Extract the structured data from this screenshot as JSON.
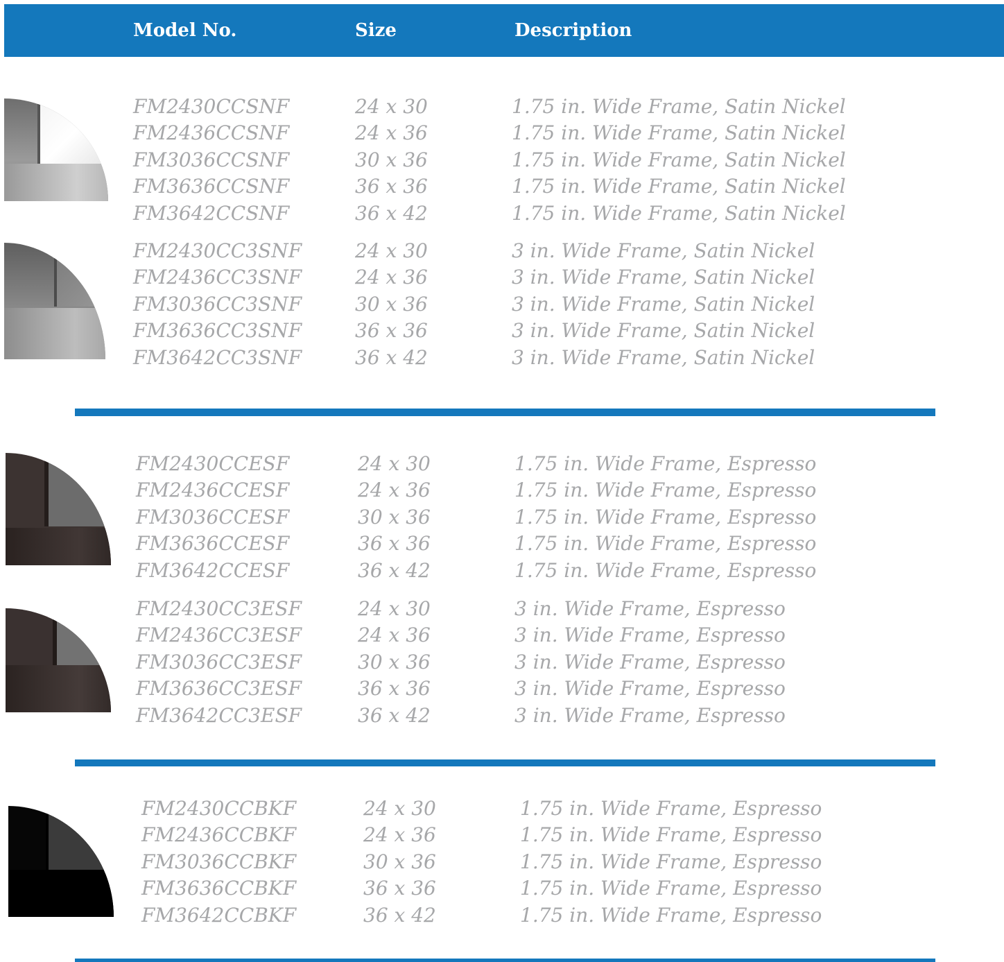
{
  "header": {
    "model_label": "Model No.",
    "size_label": "Size",
    "description_label": "Description"
  },
  "groups": [
    {
      "finish": "Satin Nickel",
      "subgroups": [
        {
          "rows": [
            {
              "model": "FM2430CCSNF",
              "size": "24 x 30",
              "description": "1.75 in. Wide Frame, Satin Nickel"
            },
            {
              "model": "FM2436CCSNF",
              "size": "24 x 36",
              "description": "1.75 in. Wide Frame, Satin Nickel"
            },
            {
              "model": "FM3036CCSNF",
              "size": "30 x 36",
              "description": "1.75 in. Wide Frame, Satin Nickel"
            },
            {
              "model": "FM3636CCSNF",
              "size": "36 x 36",
              "description": "1.75 in. Wide Frame, Satin Nickel"
            },
            {
              "model": "FM3642CCSNF",
              "size": "36 x 42",
              "description": "1.75 in. Wide Frame, Satin Nickel"
            }
          ]
        },
        {
          "rows": [
            {
              "model": "FM2430CC3SNF",
              "size": "24 x 30",
              "description": "3 in. Wide Frame, Satin Nickel"
            },
            {
              "model": "FM2436CC3SNF",
              "size": "24 x 36",
              "description": "3 in. Wide Frame, Satin Nickel"
            },
            {
              "model": "FM3036CC3SNF",
              "size": "30 x 36",
              "description": "3 in. Wide Frame, Satin Nickel"
            },
            {
              "model": "FM3636CC3SNF",
              "size": "36 x 36",
              "description": "3 in. Wide Frame, Satin Nickel"
            },
            {
              "model": "FM3642CC3SNF",
              "size": "36 x 42",
              "description": "3 in. Wide Frame, Satin Nickel"
            }
          ]
        }
      ]
    },
    {
      "finish": "Espresso",
      "subgroups": [
        {
          "rows": [
            {
              "model": "FM2430CCESF",
              "size": "24 x 30",
              "description": "1.75 in. Wide Frame, Espresso"
            },
            {
              "model": "FM2436CCESF",
              "size": "24 x 36",
              "description": "1.75 in. Wide Frame, Espresso"
            },
            {
              "model": "FM3036CCESF",
              "size": "30 x 36",
              "description": "1.75 in. Wide Frame, Espresso"
            },
            {
              "model": "FM3636CCESF",
              "size": "36 x 36",
              "description": "1.75 in. Wide Frame, Espresso"
            },
            {
              "model": "FM3642CCESF",
              "size": "36 x 42",
              "description": "1.75 in. Wide Frame, Espresso"
            }
          ]
        },
        {
          "rows": [
            {
              "model": "FM2430CC3ESF",
              "size": "24 x 30",
              "description": "3 in. Wide Frame, Espresso"
            },
            {
              "model": "FM2436CC3ESF",
              "size": "24 x 36",
              "description": "3 in. Wide Frame, Espresso"
            },
            {
              "model": "FM3036CC3ESF",
              "size": "30 x 36",
              "description": "3 in. Wide Frame, Espresso"
            },
            {
              "model": "FM3636CC3ESF",
              "size": "36 x 36",
              "description": "3 in. Wide Frame, Espresso"
            },
            {
              "model": "FM3642CC3ESF",
              "size": "36 x 42",
              "description": "3 in. Wide Frame, Espresso"
            }
          ]
        }
      ]
    },
    {
      "finish": "Black",
      "subgroups": [
        {
          "rows": [
            {
              "model": "FM2430CCBKF",
              "size": "24 x 30",
              "description": "1.75 in. Wide Frame, Espresso"
            },
            {
              "model": "FM2436CCBKF",
              "size": "24 x 36",
              "description": "1.75 in. Wide Frame, Espresso"
            },
            {
              "model": "FM3036CCBKF",
              "size": "30 x 36",
              "description": "1.75 in. Wide Frame, Espresso"
            },
            {
              "model": "FM3636CCBKF",
              "size": "36 x 36",
              "description": "1.75 in. Wide Frame, Espresso"
            },
            {
              "model": "FM3642CCBKF",
              "size": "36 x 42",
              "description": "1.75 in. Wide Frame, Espresso"
            }
          ]
        }
      ]
    }
  ],
  "colors": {
    "accent": "#1478bc",
    "text": "#a6a7a9",
    "satin_nickel": "#8a8a8a",
    "espresso": "#3a3230",
    "black": "#050505"
  }
}
